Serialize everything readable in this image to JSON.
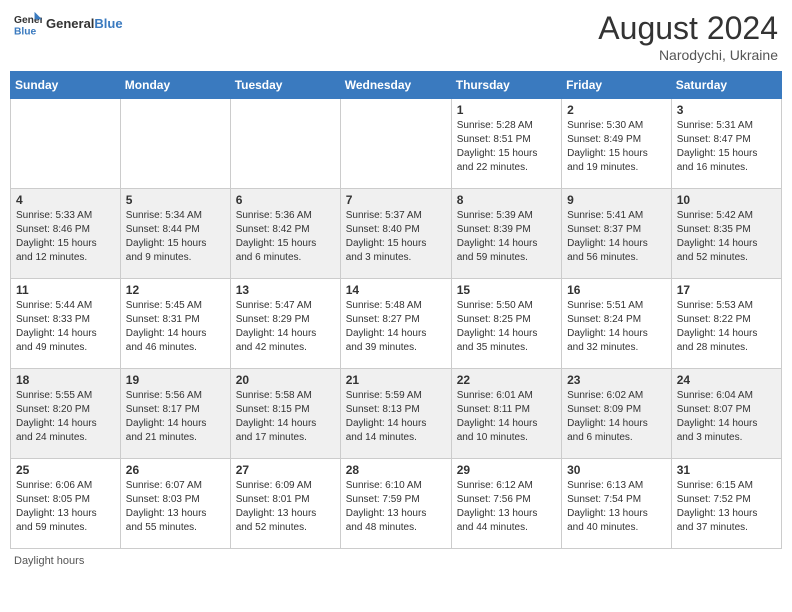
{
  "header": {
    "logo_general": "General",
    "logo_blue": "Blue",
    "month_year": "August 2024",
    "location": "Narodychi, Ukraine"
  },
  "footer": {
    "note": "Daylight hours"
  },
  "days_of_week": [
    "Sunday",
    "Monday",
    "Tuesday",
    "Wednesday",
    "Thursday",
    "Friday",
    "Saturday"
  ],
  "weeks": [
    [
      {
        "day": "",
        "info": ""
      },
      {
        "day": "",
        "info": ""
      },
      {
        "day": "",
        "info": ""
      },
      {
        "day": "",
        "info": ""
      },
      {
        "day": "1",
        "info": "Sunrise: 5:28 AM\nSunset: 8:51 PM\nDaylight: 15 hours\nand 22 minutes."
      },
      {
        "day": "2",
        "info": "Sunrise: 5:30 AM\nSunset: 8:49 PM\nDaylight: 15 hours\nand 19 minutes."
      },
      {
        "day": "3",
        "info": "Sunrise: 5:31 AM\nSunset: 8:47 PM\nDaylight: 15 hours\nand 16 minutes."
      }
    ],
    [
      {
        "day": "4",
        "info": "Sunrise: 5:33 AM\nSunset: 8:46 PM\nDaylight: 15 hours\nand 12 minutes."
      },
      {
        "day": "5",
        "info": "Sunrise: 5:34 AM\nSunset: 8:44 PM\nDaylight: 15 hours\nand 9 minutes."
      },
      {
        "day": "6",
        "info": "Sunrise: 5:36 AM\nSunset: 8:42 PM\nDaylight: 15 hours\nand 6 minutes."
      },
      {
        "day": "7",
        "info": "Sunrise: 5:37 AM\nSunset: 8:40 PM\nDaylight: 15 hours\nand 3 minutes."
      },
      {
        "day": "8",
        "info": "Sunrise: 5:39 AM\nSunset: 8:39 PM\nDaylight: 14 hours\nand 59 minutes."
      },
      {
        "day": "9",
        "info": "Sunrise: 5:41 AM\nSunset: 8:37 PM\nDaylight: 14 hours\nand 56 minutes."
      },
      {
        "day": "10",
        "info": "Sunrise: 5:42 AM\nSunset: 8:35 PM\nDaylight: 14 hours\nand 52 minutes."
      }
    ],
    [
      {
        "day": "11",
        "info": "Sunrise: 5:44 AM\nSunset: 8:33 PM\nDaylight: 14 hours\nand 49 minutes."
      },
      {
        "day": "12",
        "info": "Sunrise: 5:45 AM\nSunset: 8:31 PM\nDaylight: 14 hours\nand 46 minutes."
      },
      {
        "day": "13",
        "info": "Sunrise: 5:47 AM\nSunset: 8:29 PM\nDaylight: 14 hours\nand 42 minutes."
      },
      {
        "day": "14",
        "info": "Sunrise: 5:48 AM\nSunset: 8:27 PM\nDaylight: 14 hours\nand 39 minutes."
      },
      {
        "day": "15",
        "info": "Sunrise: 5:50 AM\nSunset: 8:25 PM\nDaylight: 14 hours\nand 35 minutes."
      },
      {
        "day": "16",
        "info": "Sunrise: 5:51 AM\nSunset: 8:24 PM\nDaylight: 14 hours\nand 32 minutes."
      },
      {
        "day": "17",
        "info": "Sunrise: 5:53 AM\nSunset: 8:22 PM\nDaylight: 14 hours\nand 28 minutes."
      }
    ],
    [
      {
        "day": "18",
        "info": "Sunrise: 5:55 AM\nSunset: 8:20 PM\nDaylight: 14 hours\nand 24 minutes."
      },
      {
        "day": "19",
        "info": "Sunrise: 5:56 AM\nSunset: 8:17 PM\nDaylight: 14 hours\nand 21 minutes."
      },
      {
        "day": "20",
        "info": "Sunrise: 5:58 AM\nSunset: 8:15 PM\nDaylight: 14 hours\nand 17 minutes."
      },
      {
        "day": "21",
        "info": "Sunrise: 5:59 AM\nSunset: 8:13 PM\nDaylight: 14 hours\nand 14 minutes."
      },
      {
        "day": "22",
        "info": "Sunrise: 6:01 AM\nSunset: 8:11 PM\nDaylight: 14 hours\nand 10 minutes."
      },
      {
        "day": "23",
        "info": "Sunrise: 6:02 AM\nSunset: 8:09 PM\nDaylight: 14 hours\nand 6 minutes."
      },
      {
        "day": "24",
        "info": "Sunrise: 6:04 AM\nSunset: 8:07 PM\nDaylight: 14 hours\nand 3 minutes."
      }
    ],
    [
      {
        "day": "25",
        "info": "Sunrise: 6:06 AM\nSunset: 8:05 PM\nDaylight: 13 hours\nand 59 minutes."
      },
      {
        "day": "26",
        "info": "Sunrise: 6:07 AM\nSunset: 8:03 PM\nDaylight: 13 hours\nand 55 minutes."
      },
      {
        "day": "27",
        "info": "Sunrise: 6:09 AM\nSunset: 8:01 PM\nDaylight: 13 hours\nand 52 minutes."
      },
      {
        "day": "28",
        "info": "Sunrise: 6:10 AM\nSunset: 7:59 PM\nDaylight: 13 hours\nand 48 minutes."
      },
      {
        "day": "29",
        "info": "Sunrise: 6:12 AM\nSunset: 7:56 PM\nDaylight: 13 hours\nand 44 minutes."
      },
      {
        "day": "30",
        "info": "Sunrise: 6:13 AM\nSunset: 7:54 PM\nDaylight: 13 hours\nand 40 minutes."
      },
      {
        "day": "31",
        "info": "Sunrise: 6:15 AM\nSunset: 7:52 PM\nDaylight: 13 hours\nand 37 minutes."
      }
    ]
  ]
}
